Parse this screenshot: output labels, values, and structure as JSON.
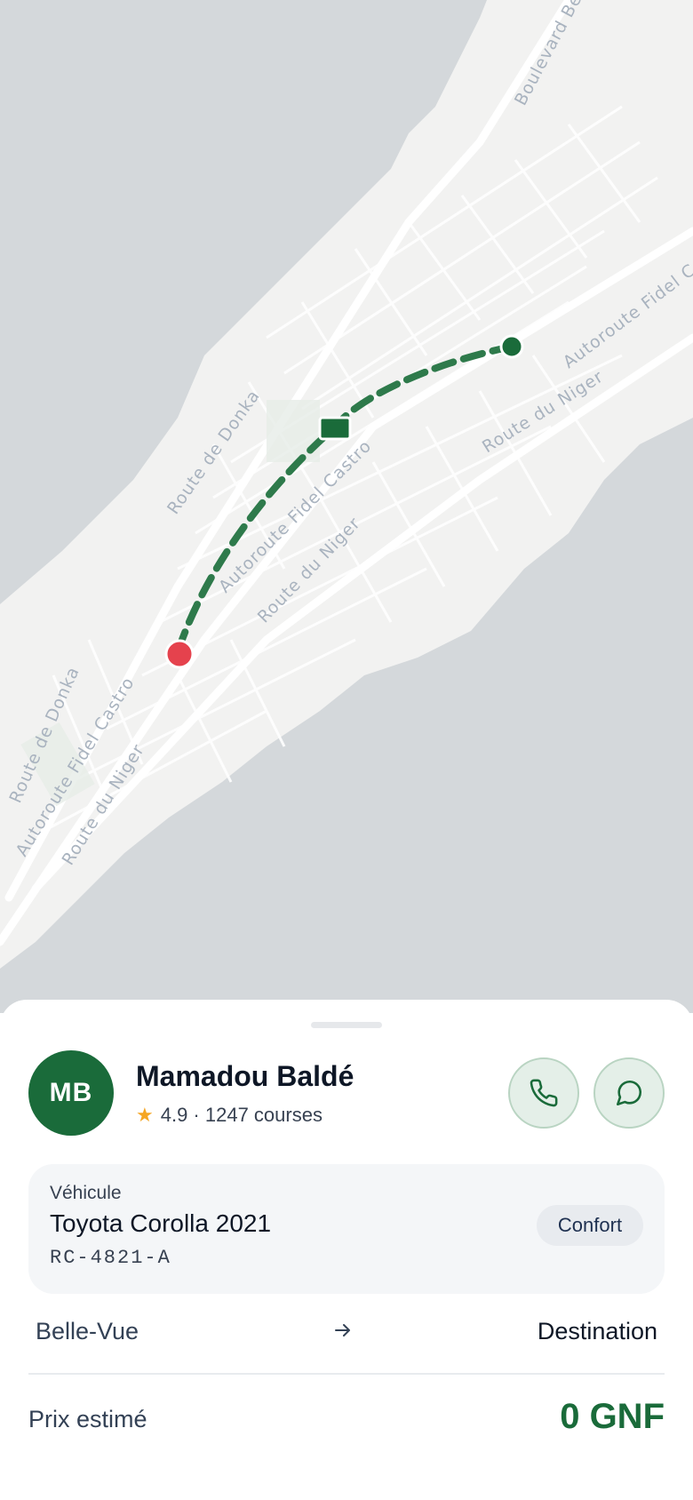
{
  "map": {
    "road_labels": [
      "Boulevard Bel",
      "Autoroute Fidel C",
      "Route du Niger",
      "Route de Donka",
      "Autoroute Fidel Castro",
      "Route du Niger",
      "Route de Donka",
      "Autoroute Fidel Castro",
      "Route du Niger"
    ]
  },
  "driver": {
    "initials": "MB",
    "name": "Mamadou Baldé",
    "rating_text": "4.9 · 1247 courses"
  },
  "vehicle": {
    "label": "Véhicule",
    "model": "Toyota Corolla 2021",
    "plate": "RC-4821-A",
    "class": "Confort"
  },
  "trip": {
    "origin": "Belle-Vue",
    "destination": "Destination",
    "price_label": "Prix estimé",
    "price_value": "0 GNF"
  },
  "colors": {
    "accent": "#1a6b3a",
    "pickup": "#e5424d",
    "route": "#2e7a4b",
    "star": "#f5a623"
  }
}
